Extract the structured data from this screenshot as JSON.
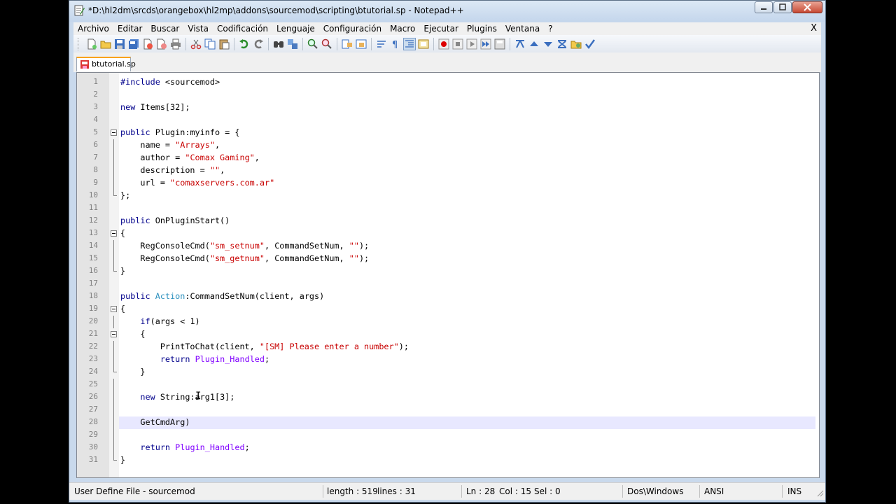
{
  "window": {
    "title": "*D:\\hl2dm\\srcds\\orangebox\\hl2mp\\addons\\sourcemod\\scripting\\btutorial.sp - Notepad++"
  },
  "menu": {
    "items": [
      "Archivo",
      "Editar",
      "Buscar",
      "Vista",
      "Codificación",
      "Lenguaje",
      "Configuración",
      "Macro",
      "Ejecutar",
      "Plugins",
      "Ventana",
      "?"
    ],
    "close": "X"
  },
  "tab": {
    "label": "btutorial.sp"
  },
  "editor": {
    "lines": [
      {
        "n": "1",
        "code": "#include <sourcemod>"
      },
      {
        "n": "2",
        "code": ""
      },
      {
        "n": "3",
        "code": "new Items[32];"
      },
      {
        "n": "4",
        "code": ""
      },
      {
        "n": "5",
        "code": "public Plugin:myinfo = {"
      },
      {
        "n": "6",
        "code": "    name = \"Arrays\","
      },
      {
        "n": "7",
        "code": "    author = \"Comax Gaming\","
      },
      {
        "n": "8",
        "code": "    description = \"\","
      },
      {
        "n": "9",
        "code": "    url = \"comaxservers.com.ar\""
      },
      {
        "n": "10",
        "code": "};"
      },
      {
        "n": "11",
        "code": ""
      },
      {
        "n": "12",
        "code": "public OnPluginStart()"
      },
      {
        "n": "13",
        "code": "{"
      },
      {
        "n": "14",
        "code": "    RegConsoleCmd(\"sm_setnum\", CommandSetNum, \"\");"
      },
      {
        "n": "15",
        "code": "    RegConsoleCmd(\"sm_getnum\", CommandGetNum, \"\");"
      },
      {
        "n": "16",
        "code": "}"
      },
      {
        "n": "17",
        "code": ""
      },
      {
        "n": "18",
        "code": "public Action:CommandSetNum(client, args)"
      },
      {
        "n": "19",
        "code": "{"
      },
      {
        "n": "20",
        "code": "    if(args < 1)"
      },
      {
        "n": "21",
        "code": "    {"
      },
      {
        "n": "22",
        "code": "        PrintToChat(client, \"[SM] Please enter a number\");"
      },
      {
        "n": "23",
        "code": "        return Plugin_Handled;"
      },
      {
        "n": "24",
        "code": "    }"
      },
      {
        "n": "25",
        "code": ""
      },
      {
        "n": "26",
        "code": "    new String:arg1[3];"
      },
      {
        "n": "27",
        "code": ""
      },
      {
        "n": "28",
        "code": "    GetCmdArg)"
      },
      {
        "n": "29",
        "code": ""
      },
      {
        "n": "30",
        "code": "    return Plugin_Handled;"
      },
      {
        "n": "31",
        "code": "}"
      }
    ],
    "current_line": 28
  },
  "status": {
    "filetype": "User Define File - sourcemod",
    "length": "length : 519",
    "lines": "lines : 31",
    "ln": "Ln : 28",
    "col": "Col : 15",
    "sel": "Sel : 0",
    "eol": "Dos\\Windows",
    "encoding": "ANSI",
    "mode": "INS"
  },
  "colors": {
    "keyword": "#00008b",
    "string": "#c80000",
    "type": "#2a8fbd",
    "constant": "#8000ff",
    "current_line_bg": "#e8e8ff",
    "tab_accent": "#f9a21b"
  },
  "toolbar_icons": [
    "new-file-icon",
    "open-file-icon",
    "save-icon",
    "save-all-icon",
    "close-icon",
    "close-all-icon",
    "print-icon",
    "cut-icon",
    "copy-icon",
    "paste-icon",
    "undo-icon",
    "redo-icon",
    "find-icon",
    "replace-icon",
    "zoom-in-icon",
    "zoom-out-icon",
    "sync-vertical-icon",
    "sync-horizontal-icon",
    "word-wrap-icon",
    "show-all-chars-icon",
    "indent-guide-icon",
    "user-lang-icon",
    "record-macro-icon",
    "stop-macro-icon",
    "play-macro-icon",
    "run-macro-multiple-icon",
    "save-macro-icon",
    "plugin-a-icon",
    "plugin-b-icon",
    "plugin-c-icon",
    "plugin-d-icon",
    "plugin-e-icon",
    "spellcheck-icon"
  ]
}
